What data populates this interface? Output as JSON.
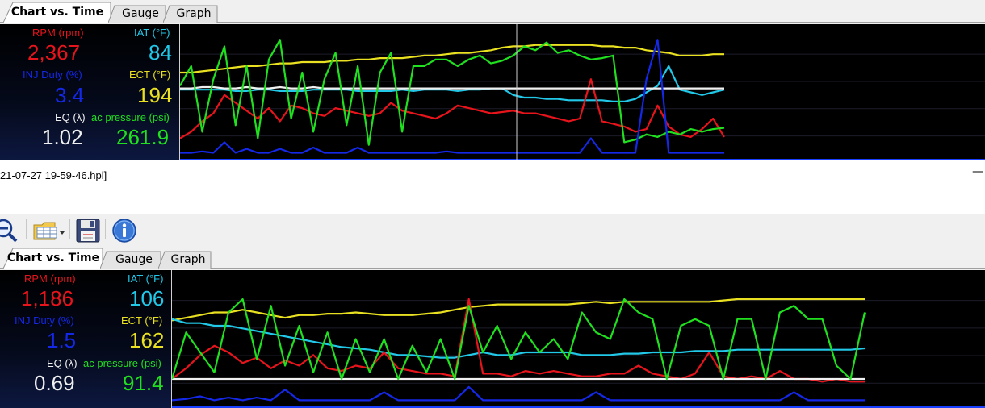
{
  "window": {
    "filename": "21-07-27 19-59-46.hpl]",
    "minimize_glyph": "—"
  },
  "toolbar": {
    "icons": [
      "zoom-out-icon",
      "open-layout-icon",
      "save-icon",
      "info-icon"
    ]
  },
  "top_panel": {
    "tabs": [
      {
        "label": "Chart vs. Time",
        "active": true
      },
      {
        "label": "Gauge",
        "active": false
      },
      {
        "label": "Graph",
        "active": false
      }
    ],
    "readouts": {
      "rpm_label": "RPM (rpm)",
      "rpm_value": "2,367",
      "iat_label": "IAT (°F)",
      "iat_value": "84",
      "inj_label": "INJ Duty (%)",
      "inj_value": "3.4",
      "ect_label": "ECT (°F)",
      "ect_value": "194",
      "eq_label": "EQ (λ)",
      "eq_value": "1.02",
      "ac_label": "ac pressure (psi)",
      "ac_value": "261.9"
    }
  },
  "bottom_panel": {
    "tabs": [
      {
        "label": "Chart vs. Time",
        "active": true
      },
      {
        "label": "Gauge",
        "active": false
      },
      {
        "label": "Graph",
        "active": false
      }
    ],
    "readouts": {
      "rpm_label": "RPM (rpm)",
      "rpm_value": "1,186",
      "iat_label": "IAT (°F)",
      "iat_value": "106",
      "inj_label": "INJ Duty (%)",
      "inj_value": "1.5",
      "ect_label": "ECT (°F)",
      "ect_value": "162",
      "eq_label": "EQ (λ)",
      "eq_value": "0.69",
      "ac_label": "ac pressure (psi)",
      "ac_value": "91.4"
    }
  },
  "colors": {
    "rpm": "#e8141c",
    "iat": "#22c8e8",
    "inj": "#1428e8",
    "ect": "#e8e020",
    "eq": "#f0f0f0",
    "ac": "#20e020"
  },
  "chart_data": [
    {
      "type": "line",
      "series": [
        {
          "name": "RPM (rpm)",
          "color_key": "rpm",
          "y": [
            0.85,
            0.8,
            0.72,
            0.66,
            0.52,
            0.58,
            0.64,
            0.7,
            0.62,
            0.72,
            0.6,
            0.62,
            0.66,
            0.68,
            0.62,
            0.64,
            0.66,
            0.68,
            0.66,
            0.58,
            0.64,
            0.66,
            0.68,
            0.7,
            0.66,
            0.6,
            0.62,
            0.64,
            0.66,
            0.65,
            0.64,
            0.66,
            0.66,
            0.68,
            0.7,
            0.72,
            0.7,
            0.4,
            0.72,
            0.74,
            0.76,
            0.8,
            0.78,
            0.6,
            0.76,
            0.82,
            0.84,
            0.78,
            0.7,
            0.84
          ]
        },
        {
          "name": "IAT (°F)",
          "color_key": "iat",
          "y": [
            0.48,
            0.48,
            0.48,
            0.48,
            0.48,
            0.49,
            0.49,
            0.48,
            0.48,
            0.49,
            0.49,
            0.49,
            0.48,
            0.48,
            0.48,
            0.48,
            0.49,
            0.49,
            0.49,
            0.49,
            0.48,
            0.49,
            0.48,
            0.48,
            0.48,
            0.49,
            0.48,
            0.48,
            0.47,
            0.47,
            0.52,
            0.54,
            0.54,
            0.55,
            0.55,
            0.56,
            0.56,
            0.56,
            0.56,
            0.57,
            0.57,
            0.55,
            0.5,
            0.45,
            0.3,
            0.48,
            0.5,
            0.52,
            0.5,
            0.48
          ]
        },
        {
          "name": "INJ Duty (%)",
          "color_key": "inj",
          "y": [
            0.96,
            0.96,
            0.95,
            0.96,
            0.88,
            0.96,
            0.93,
            0.96,
            0.96,
            0.93,
            0.96,
            0.96,
            0.92,
            0.96,
            0.96,
            0.96,
            0.92,
            0.96,
            0.96,
            0.96,
            0.96,
            0.96,
            0.96,
            0.96,
            0.95,
            0.96,
            0.96,
            0.96,
            0.96,
            0.96,
            0.96,
            0.96,
            0.96,
            0.96,
            0.96,
            0.96,
            0.96,
            0.85,
            0.96,
            0.96,
            0.96,
            0.96,
            0.4,
            0.1,
            0.96,
            0.96,
            0.96,
            0.96,
            0.96,
            0.96
          ]
        },
        {
          "name": "ECT (°F)",
          "color_key": "ect",
          "y": [
            0.35,
            0.35,
            0.34,
            0.33,
            0.32,
            0.31,
            0.3,
            0.3,
            0.29,
            0.28,
            0.28,
            0.27,
            0.27,
            0.27,
            0.26,
            0.26,
            0.25,
            0.25,
            0.24,
            0.24,
            0.24,
            0.23,
            0.22,
            0.22,
            0.21,
            0.2,
            0.2,
            0.19,
            0.18,
            0.16,
            0.15,
            0.15,
            0.14,
            0.14,
            0.14,
            0.14,
            0.14,
            0.14,
            0.15,
            0.15,
            0.16,
            0.16,
            0.18,
            0.19,
            0.2,
            0.22,
            0.22,
            0.22,
            0.21,
            0.21
          ]
        },
        {
          "name": "EQ (λ)",
          "color_key": "eq",
          "y": [
            0.47,
            0.47,
            0.46,
            0.46,
            0.47,
            0.47,
            0.46,
            0.47,
            0.47,
            0.46,
            0.47,
            0.47,
            0.46,
            0.47,
            0.47,
            0.47,
            0.47,
            0.47,
            0.47,
            0.47,
            0.47,
            0.47,
            0.47,
            0.47,
            0.47,
            0.47,
            0.47,
            0.47,
            0.47,
            0.47,
            0.47,
            0.47,
            0.47,
            0.47,
            0.47,
            0.47,
            0.47,
            0.47,
            0.47,
            0.47,
            0.47,
            0.47,
            0.47,
            0.47,
            0.47,
            0.47,
            0.47,
            0.47,
            0.47,
            0.47
          ]
        },
        {
          "name": "ac pressure (psi)",
          "color_key": "ac",
          "y": [
            0.45,
            0.3,
            0.8,
            0.4,
            0.15,
            0.75,
            0.3,
            0.85,
            0.25,
            0.1,
            0.7,
            0.35,
            0.8,
            0.4,
            0.2,
            0.75,
            0.3,
            0.9,
            0.35,
            0.2,
            0.8,
            0.3,
            0.3,
            0.25,
            0.25,
            0.3,
            0.25,
            0.22,
            0.28,
            0.26,
            0.22,
            0.15,
            0.18,
            0.12,
            0.2,
            0.18,
            0.22,
            0.25,
            0.24,
            0.22,
            0.88,
            0.86,
            0.82,
            0.84,
            0.8,
            0.82,
            0.78,
            0.8,
            0.78,
            0.77
          ]
        }
      ]
    },
    {
      "type": "line",
      "series": [
        {
          "name": "RPM (rpm)",
          "color_key": "rpm",
          "y": [
            0.8,
            0.72,
            0.62,
            0.55,
            0.6,
            0.68,
            0.64,
            0.72,
            0.66,
            0.7,
            0.62,
            0.72,
            0.74,
            0.7,
            0.72,
            0.6,
            0.72,
            0.74,
            0.76,
            0.76,
            0.78,
            0.2,
            0.76,
            0.76,
            0.78,
            0.74,
            0.76,
            0.74,
            0.76,
            0.78,
            0.78,
            0.76,
            0.76,
            0.7,
            0.76,
            0.78,
            0.8,
            0.76,
            0.6,
            0.78,
            0.8,
            0.78,
            0.8,
            0.74,
            0.8,
            0.8,
            0.82,
            0.8,
            0.82,
            0.82
          ]
        },
        {
          "name": "IAT (°F)",
          "color_key": "iat",
          "y": [
            0.35,
            0.38,
            0.38,
            0.4,
            0.4,
            0.42,
            0.44,
            0.46,
            0.48,
            0.5,
            0.52,
            0.54,
            0.56,
            0.57,
            0.58,
            0.6,
            0.62,
            0.62,
            0.63,
            0.64,
            0.64,
            0.62,
            0.6,
            0.62,
            0.62,
            0.6,
            0.6,
            0.6,
            0.6,
            0.62,
            0.62,
            0.62,
            0.61,
            0.61,
            0.6,
            0.6,
            0.6,
            0.59,
            0.59,
            0.59,
            0.58,
            0.58,
            0.58,
            0.58,
            0.58,
            0.58,
            0.58,
            0.58,
            0.58,
            0.57
          ]
        },
        {
          "name": "INJ Duty (%)",
          "color_key": "inj",
          "y": [
            0.96,
            0.95,
            0.93,
            0.96,
            0.94,
            0.96,
            0.94,
            0.96,
            0.88,
            0.96,
            0.96,
            0.96,
            0.96,
            0.96,
            0.96,
            0.9,
            0.96,
            0.96,
            0.96,
            0.96,
            0.96,
            0.86,
            0.96,
            0.96,
            0.96,
            0.96,
            0.96,
            0.96,
            0.96,
            0.96,
            0.9,
            0.96,
            0.96,
            0.96,
            0.96,
            0.96,
            0.96,
            0.96,
            0.96,
            0.96,
            0.96,
            0.96,
            0.96,
            0.96,
            0.9,
            0.96,
            0.96,
            0.96,
            0.96,
            0.96
          ]
        },
        {
          "name": "ECT (°F)",
          "color_key": "ect",
          "y": [
            0.36,
            0.34,
            0.32,
            0.3,
            0.3,
            0.28,
            0.3,
            0.32,
            0.34,
            0.32,
            0.32,
            0.31,
            0.31,
            0.3,
            0.31,
            0.32,
            0.32,
            0.32,
            0.31,
            0.3,
            0.28,
            0.26,
            0.25,
            0.24,
            0.24,
            0.24,
            0.24,
            0.24,
            0.24,
            0.23,
            0.22,
            0.23,
            0.22,
            0.22,
            0.22,
            0.22,
            0.22,
            0.22,
            0.22,
            0.21,
            0.2,
            0.2,
            0.2,
            0.2,
            0.2,
            0.2,
            0.2,
            0.2,
            0.2,
            0.2
          ]
        },
        {
          "name": "EQ (λ)",
          "color_key": "eq",
          "y": [
            0.8,
            0.8,
            0.8,
            0.8,
            0.8,
            0.8,
            0.8,
            0.8,
            0.8,
            0.8,
            0.8,
            0.8,
            0.8,
            0.8,
            0.8,
            0.8,
            0.8,
            0.8,
            0.8,
            0.8,
            0.8,
            0.8,
            0.8,
            0.8,
            0.8,
            0.8,
            0.8,
            0.8,
            0.8,
            0.8,
            0.8,
            0.8,
            0.8,
            0.8,
            0.8,
            0.8,
            0.8,
            0.8,
            0.8,
            0.8,
            0.8,
            0.8,
            0.8,
            0.8,
            0.8,
            0.8,
            0.8,
            0.8,
            0.8,
            0.8
          ]
        },
        {
          "name": "ac pressure (psi)",
          "color_key": "ac",
          "y": [
            0.8,
            0.45,
            0.6,
            0.75,
            0.3,
            0.2,
            0.65,
            0.25,
            0.7,
            0.4,
            0.75,
            0.45,
            0.8,
            0.5,
            0.75,
            0.5,
            0.8,
            0.55,
            0.75,
            0.5,
            0.8,
            0.25,
            0.6,
            0.4,
            0.65,
            0.45,
            0.6,
            0.5,
            0.65,
            0.3,
            0.45,
            0.5,
            0.2,
            0.3,
            0.35,
            0.8,
            0.4,
            0.35,
            0.4,
            0.8,
            0.35,
            0.35,
            0.8,
            0.3,
            0.25,
            0.35,
            0.35,
            0.7,
            0.8,
            0.3
          ]
        }
      ]
    }
  ]
}
